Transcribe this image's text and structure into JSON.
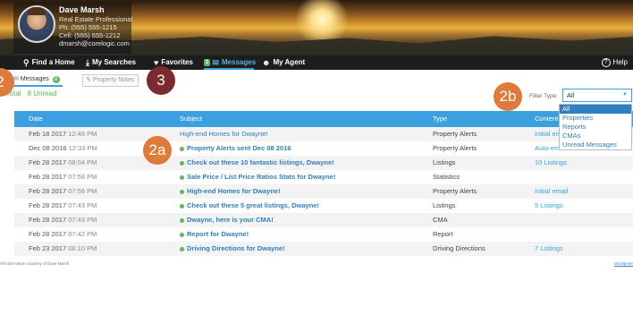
{
  "agent": {
    "name": "Dave Marsh",
    "title": "Real Estate Professional",
    "phone": "Ph: (555) 555-1215",
    "cell": "Cell: (555) 555-1212",
    "email": "dmarsh@corelogic.com"
  },
  "nav": {
    "items": [
      {
        "label": "Find a Home",
        "icon": "search-icon"
      },
      {
        "label": "My Searches",
        "icon": "download-icon"
      },
      {
        "label": "Favorites",
        "icon": "heart-icon"
      },
      {
        "label": "Messages",
        "icon": "envelope-icon",
        "badge": "1"
      },
      {
        "label": "My Agent",
        "icon": "person-icon"
      }
    ],
    "help": "Help",
    "help_icon": "question-circle-icon"
  },
  "subtabs": {
    "messages": "Messages",
    "messages_count": "8",
    "property_notes": "Property Notes"
  },
  "counts": {
    "total": "9 Total",
    "unread": "8 Unread"
  },
  "filter": {
    "label": "Filter Type:",
    "selected": "All",
    "options": [
      "All",
      "Properties",
      "Reports",
      "CMAs",
      "Unread Messages"
    ]
  },
  "table": {
    "headers": [
      "Date",
      "Subject",
      "Type",
      "Content"
    ],
    "rows": [
      {
        "date": "Feb 18 2017",
        "time": "12:46 PM",
        "subject": "High-end Homes for Dwayne!",
        "unread": false,
        "type": "Property Alerts",
        "content": "Initial email"
      },
      {
        "date": "Dec 08 2016",
        "time": "12:33 PM",
        "subject": "Property Alerts sent Dec 08 2016",
        "unread": true,
        "type": "Property Alerts",
        "content": "Auto-email re-activated"
      },
      {
        "date": "Feb 28 2017",
        "time": "08:04 PM",
        "subject": "Check out these 10 fantastic listings, Dwayne!",
        "unread": true,
        "type": "Listings",
        "content": "10 Listings"
      },
      {
        "date": "Feb 28 2017",
        "time": "07:58 PM",
        "subject": "Sale Price / List Price Ratios Stats for Dwayne!",
        "unread": true,
        "type": "Statistics",
        "content": ""
      },
      {
        "date": "Feb 28 2017",
        "time": "07:56 PM",
        "subject": "High-end Homes for Dwayne!",
        "unread": true,
        "type": "Property Alerts",
        "content": "Initial email"
      },
      {
        "date": "Feb 28 2017",
        "time": "07:43 PM",
        "subject": "Check out these 5 great listings, Dwayne!",
        "unread": true,
        "type": "Listings",
        "content": "5 Listings"
      },
      {
        "date": "Feb 28 2017",
        "time": "07:43 PM",
        "subject": "Dwayne, here is your CMA!",
        "unread": true,
        "type": "CMA",
        "content": ""
      },
      {
        "date": "Feb 28 2017",
        "time": "07:42 PM",
        "subject": "Report for Dwayne!",
        "unread": true,
        "type": "Report",
        "content": ""
      },
      {
        "date": "Feb 23 2017",
        "time": "06:10 PM",
        "subject": "Driving Directions for Dwayne!",
        "unread": true,
        "type": "Driving Directions",
        "content": "7 Listings"
      }
    ]
  },
  "footer": {
    "note": "All information courtesy of Dave Marsh",
    "disclaimer": "Disclaimer"
  },
  "callouts": {
    "c2": "2",
    "c3": "3",
    "c2a": "2a",
    "c2b": "2b"
  },
  "colors": {
    "accent": "#3aa0e0",
    "unread_dot": "#5cb85c",
    "callout_orange": "#e07a3a",
    "callout_maroon": "#7b2a2e"
  }
}
